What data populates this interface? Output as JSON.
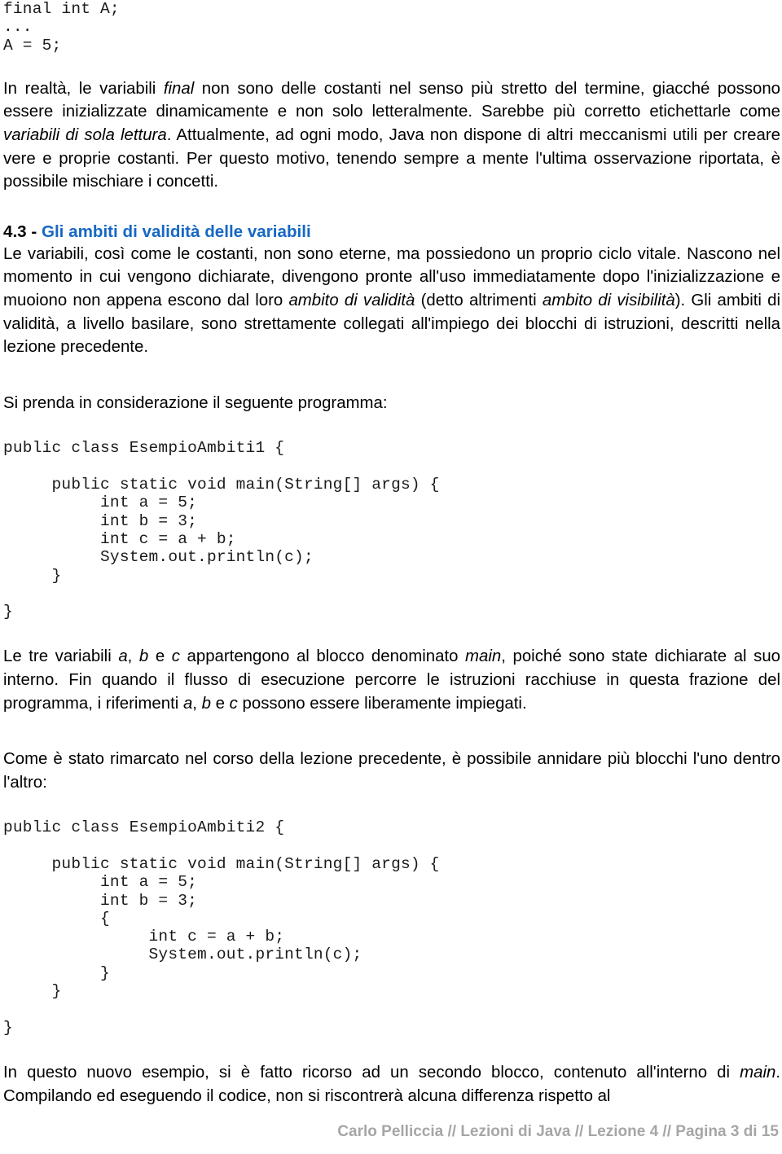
{
  "document": {
    "language": "it",
    "accent_color": "#1668c4",
    "footer_color": "#a6a6a6"
  },
  "top_code_snippet": {
    "lines": [
      "final int A;",
      "...",
      "A = 5;"
    ],
    "text": "final int A;\n...\nA = 5;"
  },
  "paragraphs": {
    "p1": {
      "part1": "In realtà, le variabili ",
      "em1": "final",
      "part2": " non sono delle costanti nel senso più stretto del termine, giacché possono essere inizializzate dinamicamente e non solo letteralmente. Sarebbe più corretto etichettarle come ",
      "em2": "variabili di sola lettura",
      "part3": ". Attualmente, ad ogni modo, Java non dispone di altri meccanismi utili per creare vere e proprie costanti. Per questo motivo, tenendo sempre a mente l'ultima osservazione riportata, è possibile mischiare i concetti."
    },
    "p2": {
      "part1": "Le variabili, così come le costanti, non sono eterne, ma possiedono un proprio ciclo vitale. Nascono nel momento in cui vengono dichiarate, divengono pronte all'uso immediatamente dopo l'inizializzazione e muoiono non appena escono dal loro ",
      "em1": "ambito di validità",
      "part2": " (detto altrimenti ",
      "em2": "ambito di visibilità",
      "part3": "). Gli ambiti di validità, a livello basilare, sono strettamente collegati all'impiego dei blocchi di istruzioni, descritti nella lezione precedente."
    },
    "p3": {
      "text": "Si prenda in considerazione il seguente programma:"
    },
    "p4": {
      "part1": "Le tre variabili ",
      "em1": "a",
      "part2": ", ",
      "em2": "b",
      "part3": " e ",
      "em3": "c",
      "part4": " appartengono al blocco denominato ",
      "em4": "main",
      "part5": ", poiché sono state dichiarate al suo interno. Fin quando il flusso di esecuzione percorre le istruzioni racchiuse in questa frazione del programma, i riferimenti ",
      "em5": "a",
      "part6": ", ",
      "em6": "b",
      "part7": " e ",
      "em7": "c",
      "part8": " possono essere liberamente impiegati."
    },
    "p5": {
      "text": "Come è stato rimarcato nel corso della lezione precedente, è possibile annidare più blocchi l'uno dentro l'altro:"
    },
    "p6": {
      "part1": "In questo nuovo esempio, si è fatto ricorso ad un secondo blocco, contenuto all'interno di ",
      "em1": "main",
      "part2": ". Compilando ed eseguendo il codice, non si riscontrerà alcuna differenza rispetto al"
    }
  },
  "section_heading": {
    "number": "4.3 - ",
    "title": "Gli ambiti di validità delle variabili"
  },
  "code_block_1": {
    "class_name": "EsempioAmbiti1",
    "lines": [
      "public class EsempioAmbiti1 {",
      "",
      "     public static void main(String[] args) {",
      "          int a = 5;",
      "          int b = 3;",
      "          int c = a + b;",
      "          System.out.println(c);",
      "     }",
      "",
      "}"
    ],
    "text": "public class EsempioAmbiti1 {\n\n     public static void main(String[] args) {\n          int a = 5;\n          int b = 3;\n          int c = a + b;\n          System.out.println(c);\n     }\n\n}"
  },
  "code_block_2": {
    "class_name": "EsempioAmbiti2",
    "lines": [
      "public class EsempioAmbiti2 {",
      "",
      "     public static void main(String[] args) {",
      "          int a = 5;",
      "          int b = 3;",
      "          {",
      "               int c = a + b;",
      "               System.out.println(c);",
      "          }",
      "     }",
      "",
      "}"
    ],
    "text": "public class EsempioAmbiti2 {\n\n     public static void main(String[] args) {\n          int a = 5;\n          int b = 3;\n          {\n               int c = a + b;\n               System.out.println(c);\n          }\n     }\n\n}"
  },
  "footer": {
    "text": "Carlo Pelliccia // Lezioni di Java // Lezione 4 // Pagina 3 di 15",
    "author": "Carlo Pelliccia",
    "series": "Lezioni di Java",
    "lesson": "Lezione 4",
    "page": "Pagina 3 di 15"
  }
}
